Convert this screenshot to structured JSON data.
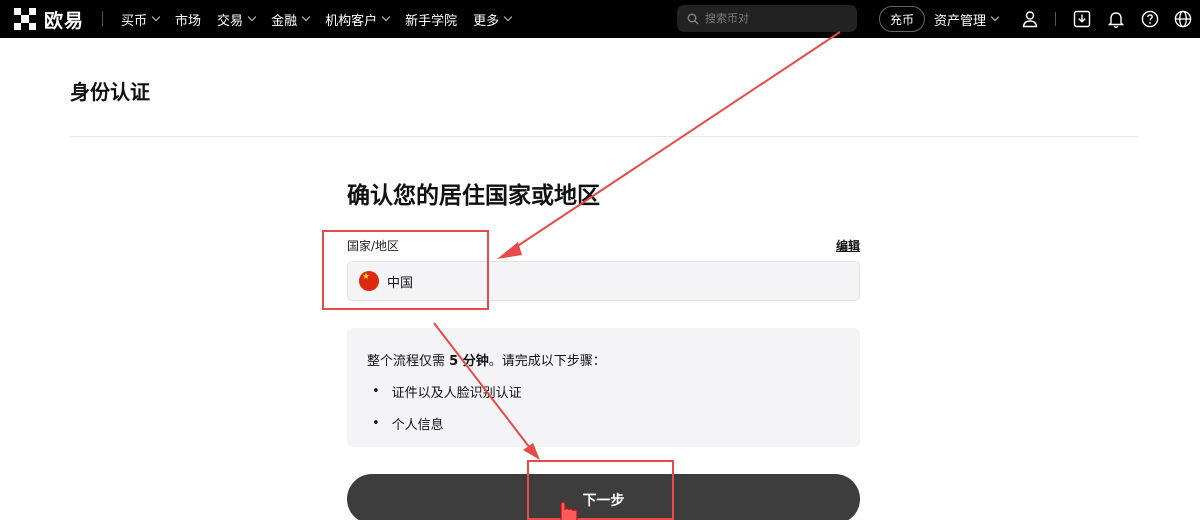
{
  "nav": {
    "logo_text": "欧易",
    "items": [
      {
        "label": "买币",
        "dropdown": true
      },
      {
        "label": "市场",
        "dropdown": false
      },
      {
        "label": "交易",
        "dropdown": true
      },
      {
        "label": "金融",
        "dropdown": true
      },
      {
        "label": "机构客户",
        "dropdown": true
      },
      {
        "label": "新手学院",
        "dropdown": false
      },
      {
        "label": "更多",
        "dropdown": true
      }
    ],
    "search_placeholder": "搜索币对",
    "deposit_label": "充币",
    "assets_label": "资产管理",
    "icons": [
      "user-icon",
      "download-icon",
      "bell-icon",
      "help-icon",
      "globe-icon"
    ]
  },
  "page": {
    "title": "身份认证",
    "heading": "确认您的居住国家或地区",
    "field_label": "国家/地区",
    "edit_label": "编辑",
    "country": "中国",
    "info": {
      "prefix": "整个流程仅需 ",
      "emphasis": "5 分钟",
      "suffix": "。请完成以下步骤：",
      "steps": [
        "证件以及人脸识别认证",
        "个人信息"
      ]
    },
    "next_label": "下一步"
  },
  "colors": {
    "nav_bg": "#000000",
    "button_bg": "#3d3d3d",
    "annotation": "#e84a4a",
    "flag_red": "#de2910"
  }
}
